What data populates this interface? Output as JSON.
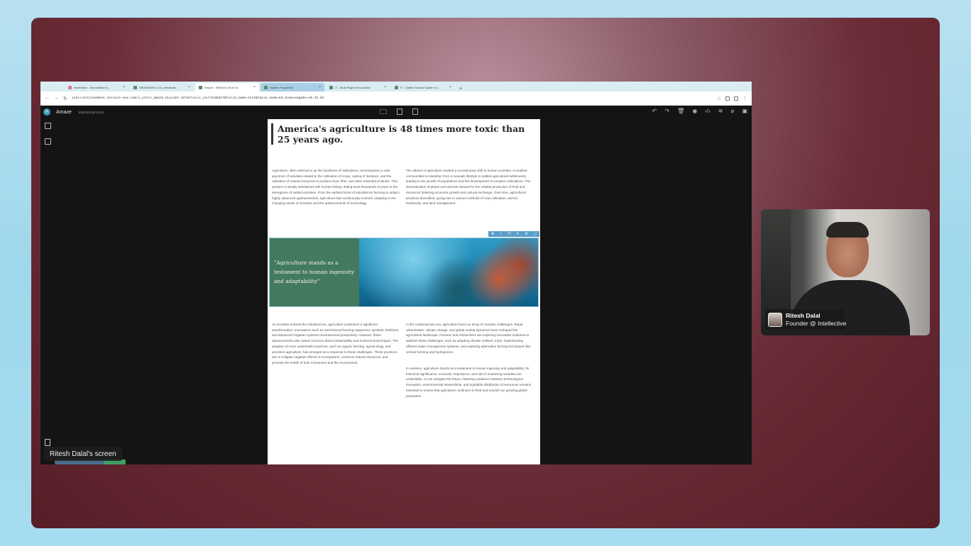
{
  "browser": {
    "tabs": [
      {
        "label": "Intellective - ServiceNow in...",
        "favicon": "pink"
      },
      {
        "label": "KB0009458 v1.01 | Intellectiv...",
        "favicon": "green"
      },
      {
        "label": "Amaze - KB0010128 v0.01",
        "favicon": "green",
        "active": true
      },
      {
        "label": "System Properties",
        "favicon": "green",
        "highlight": true
      },
      {
        "label": "IT - Multi-Page Demo article",
        "favicon": "green"
      },
      {
        "label": "IT - Unified Search System ro...",
        "favicon": "green"
      }
    ],
    "new_tab": "+",
    "url": "intellectivedemo1.service-now.com/x_intel_amaze_builder.do?article_id=f4c8b2e7&field_name=text&table_name=kb_knowledge&v=v0.31.04"
  },
  "app": {
    "logo": "A",
    "name": "Amaze",
    "record": "KB0010128 v0.01"
  },
  "article": {
    "title": "America's agriculture is 48 times more toxic than 25 years ago.",
    "col1": "Agriculture, often referred to as the backbone of civilizations, encompasses a vast spectrum of activities related to the cultivation of crops, raising of livestock, and the utilization of natural resources to produce food, fiber, and other essential products. This practice is deeply intertwined with human history, dating back thousands of years to the emergence of settled societies. From the earliest forms of subsistence farming to today's highly advanced agribusinesses, agriculture has continuously evolved, adapting to the changing needs of societies and the advancements of technology.",
    "col2": "The advent of agriculture marked a revolutionary shift in human societies. It enabled communities to transition from a nomadic lifestyle to settled agricultural settlements, leading to the growth of populations and the development of complex civilizations. The domestication of plants and animals allowed for the reliable production of food and resources fostering economic growth and cultural exchange. Over time, agricultural practices diversified, giving rise to various methods of crop cultivation, animal husbandry, and land management.",
    "quote": "\"Agriculture stands as a testament to human ingenuity and adaptability\"",
    "col3": "As societies entered the industrial era, agriculture underwent a significant transformation. Innovations such as mechanized farming equipment, synthetic fertilizers, and advanced irrigation systems revolutionized productivity. However, these advancements also raised concerns about sustainability and environmental impact. The adoption of more sustainable practices, such as organic farming, agroecology, and precision agriculture, has emerged as a response to these challenges. These practices aim to mitigate negative effects on ecosystems, conserve natural resources, and promote the health of both consumers and the environment.",
    "col4a": "In the contemporary era, agriculture faces an array of complex challenges. Rapid urbanization, climate change, and global market dynamics have reshaped the agricultural landscape. Farmers and researchers are exploring innovative solutions to address these challenges, such as adopting climate-resilient crops, implementing efficient water management systems, and exploring alternative farming techniques like vertical farming and hydroponics.",
    "col4b": "In essence, agriculture stands as a testament to human ingenuity and adaptability. Its historical significance, economic importance, and role in sustaining societies are undeniable. As we navigate the future, fostering a balance between technological innovation, environmental stewardship, and equitable distribution of resources remains essential to ensure that agriculture continues to feed and nourish our growing global population."
  },
  "screen_label": "Ritesh Dalal's screen",
  "participant": {
    "name": "Ritesh Dalal",
    "role": "Founder @ Intellective"
  },
  "icons": [
    "back-icon",
    "forward-icon",
    "reload-icon",
    "star-icon",
    "undo-icon",
    "redo-icon",
    "delete-icon",
    "preview-icon",
    "code-icon",
    "layers-icon",
    "attach-icon",
    "save-icon"
  ],
  "colors": {
    "quote_bg": "#437a5e",
    "accent": "#3d9bb3"
  }
}
